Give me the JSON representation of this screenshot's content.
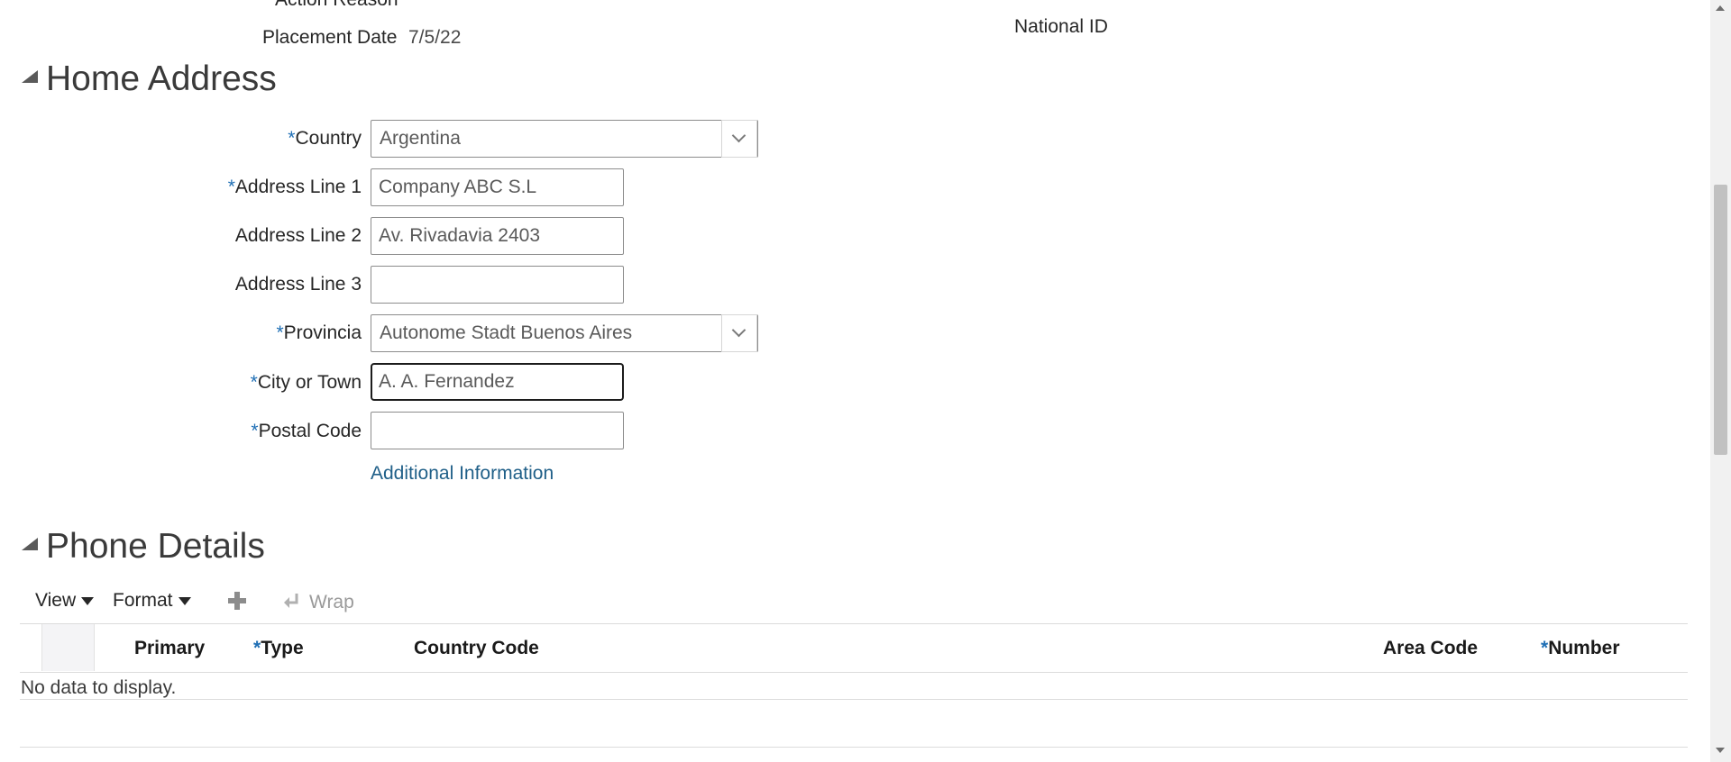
{
  "top": {
    "action_reason_label": "Action Reason",
    "placement_date_label": "Placement Date",
    "placement_date_value": "7/5/22",
    "national_id_label": "National ID"
  },
  "home_address": {
    "title": "Home Address",
    "required_marker": "*",
    "country": {
      "label": "Country",
      "value": "Argentina"
    },
    "address_line_1": {
      "label": "Address Line 1",
      "value": "Company ABC S.L"
    },
    "address_line_2": {
      "label": "Address Line 2",
      "value": "Av. Rivadavia 2403"
    },
    "address_line_3": {
      "label": "Address Line 3",
      "value": ""
    },
    "provincia": {
      "label": "Provincia",
      "value": "Autonome Stadt Buenos Aires"
    },
    "city": {
      "label": "City or Town",
      "value": "A. A. Fernandez"
    },
    "postal_code": {
      "label": "Postal Code",
      "value": ""
    },
    "additional_info_link": "Additional Information"
  },
  "phone_details": {
    "title": "Phone Details",
    "toolbar": {
      "view_label": "View",
      "format_label": "Format",
      "wrap_label": "Wrap"
    },
    "columns": {
      "primary": "Primary",
      "type": "Type",
      "country_code": "Country Code",
      "area_code": "Area Code",
      "number": "Number"
    },
    "empty_text": "No data to display."
  },
  "colors": {
    "required": "#1f6fb5",
    "link": "#1f5f88",
    "focus_border": "#1c1c1c"
  },
  "icons": {
    "add": "plus-icon",
    "wrap": "wrap-arrow-icon",
    "section_toggle": "disclosure-triangle-icon",
    "dropdown": "chevron-down-icon"
  }
}
